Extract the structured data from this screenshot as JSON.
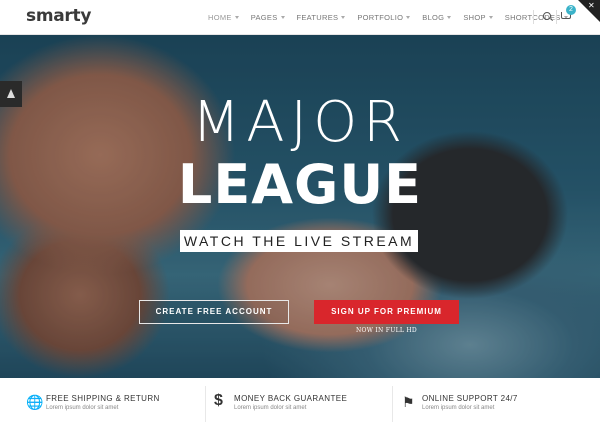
{
  "header": {
    "logo": "smarty",
    "nav": [
      "HOME",
      "PAGES",
      "FEATURES",
      "PORTFOLIO",
      "BLOG",
      "SHOP",
      "SHORTCODES"
    ],
    "cart_count": "2",
    "icons": [
      "search-icon",
      "cart-icon",
      "close-icon"
    ]
  },
  "hero": {
    "title_line1": "MAJOR",
    "title_line2": "LEAGUE",
    "subtitle": "WATCH THE LIVE STREAM",
    "btn_secondary": "CREATE FREE ACCOUNT",
    "btn_primary": "SIGN UP FOR PREMIUM",
    "note": "NOW IN FULL HD",
    "accent_color": "#d9262c"
  },
  "features": [
    {
      "icon": "globe-icon",
      "title": "FREE SHIPPING & RETURN",
      "text": "Lorem ipsum dolor sit amet"
    },
    {
      "icon": "dollar-icon",
      "title": "MONEY BACK GUARANTEE",
      "text": "Lorem ipsum dolor sit amet"
    },
    {
      "icon": "flag-icon",
      "title": "ONLINE SUPPORT 24/7",
      "text": "Lorem ipsum dolor sit amet"
    }
  ]
}
